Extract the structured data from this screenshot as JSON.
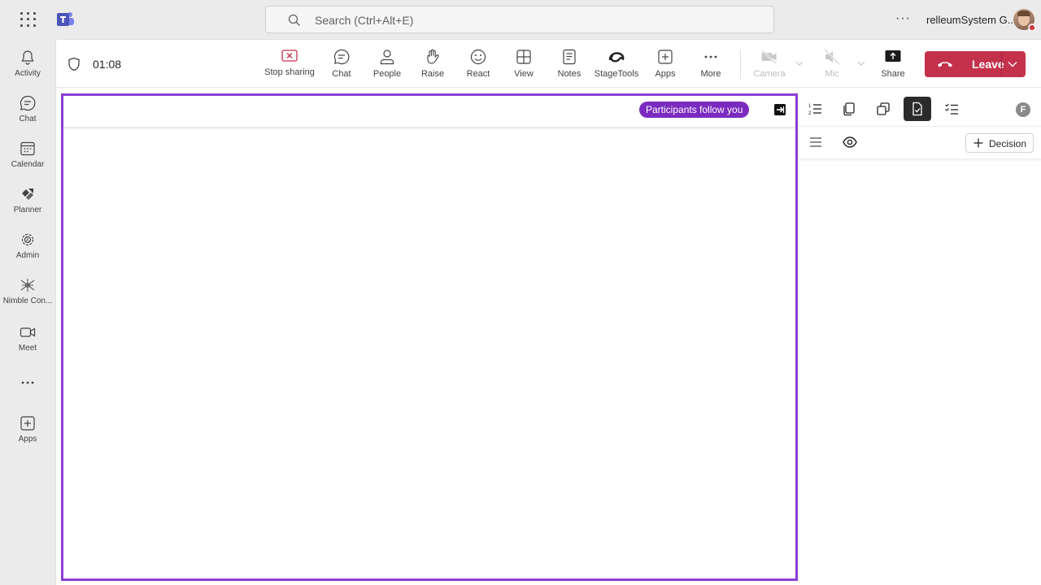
{
  "search": {
    "placeholder": "Search (Ctrl+Alt+E)"
  },
  "user": {
    "name": "relleumSystem G..."
  },
  "rail": {
    "items": [
      {
        "label": "Activity",
        "icon": "bell-icon"
      },
      {
        "label": "Chat",
        "icon": "chat-icon"
      },
      {
        "label": "Calendar",
        "icon": "calendar-icon"
      },
      {
        "label": "Planner",
        "icon": "planner-icon"
      },
      {
        "label": "Admin",
        "icon": "admin-icon"
      },
      {
        "label": "Nimble Con...",
        "icon": "nimble-icon"
      },
      {
        "label": "Meet",
        "icon": "video-icon"
      },
      {
        "label": "Apps",
        "icon": "add-app-icon"
      }
    ]
  },
  "meeting": {
    "timer": "01:08",
    "toolbar": {
      "stop_sharing": "Stop sharing",
      "chat": "Chat",
      "people": "People",
      "raise": "Raise",
      "react": "React",
      "view": "View",
      "notes": "Notes",
      "stagetools": "StageTools",
      "apps": "Apps",
      "more": "More",
      "camera": "Camera",
      "mic": "Mic",
      "share": "Share",
      "leave": "Leave"
    },
    "stage": {
      "follow_badge": "Participants follow you"
    },
    "side_panel": {
      "avatar_initial": "F",
      "decision_label": "Decision"
    }
  },
  "colors": {
    "accent_purple": "#8b3fd6",
    "leave_red": "#c4314b",
    "teams_purple": "#5b5fc7"
  }
}
